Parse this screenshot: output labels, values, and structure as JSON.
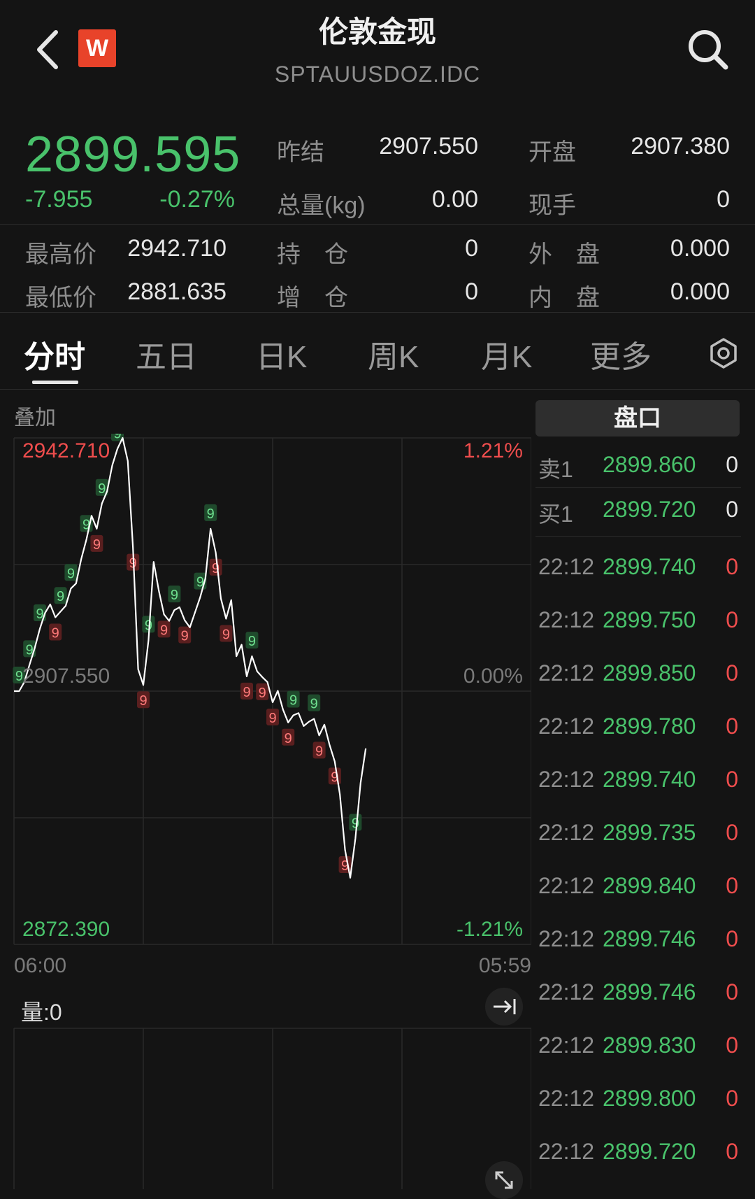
{
  "header": {
    "title": "伦敦金现",
    "subtitle": "SPTAUUSDOZ.IDC",
    "logo_letter": "W"
  },
  "quote": {
    "price": "2899.595",
    "change": "-7.955",
    "change_pct": "-0.27%",
    "fields": [
      {
        "label": "昨结",
        "value": "2907.550"
      },
      {
        "label": "开盘",
        "value": "2907.380"
      },
      {
        "label": "总量(kg)",
        "value": "0.00"
      },
      {
        "label": "现手",
        "value": "0"
      },
      {
        "label": "最高价",
        "value": "2942.710"
      },
      {
        "label": "持　仓",
        "value": "0"
      },
      {
        "label": "外　盘",
        "value": "0.000"
      },
      {
        "label": "最低价",
        "value": "2881.635"
      },
      {
        "label": "增　仓",
        "value": "0"
      },
      {
        "label": "内　盘",
        "value": "0.000"
      }
    ]
  },
  "tabs": [
    "分时",
    "五日",
    "日K",
    "周K",
    "月K",
    "更多"
  ],
  "chart": {
    "overlay_label": "叠加",
    "y_max_label": "2942.710",
    "y_mid_label": "2907.550",
    "y_min_label": "2872.390",
    "pct_max_label": "1.21%",
    "pct_mid_label": "0.00%",
    "pct_min_label": "-1.21%",
    "time_start": "06:00",
    "time_end": "05:59",
    "volume_label": "量:0"
  },
  "chart_data": {
    "type": "line",
    "title": "",
    "xlabel": "",
    "ylabel": "",
    "ylim": [
      2872.39,
      2942.71
    ],
    "x_range": [
      "06:00",
      "05:59"
    ],
    "reference": 2907.55,
    "series": [
      {
        "values": [
          2907.55,
          2907.55,
          2908.8,
          2911.2,
          2913.5,
          2916.2,
          2918.4,
          2919.6,
          2917.8,
          2918.6,
          2919.4,
          2921.8,
          2922.5,
          2925.9,
          2928.6,
          2931.9,
          2930.1,
          2933.6,
          2935.3,
          2938.9,
          2941.2,
          2942.71,
          2939.5,
          2927.5,
          2910.6,
          2908.4,
          2914.6,
          2925.5,
          2921.5,
          2918.2,
          2917.3,
          2918.8,
          2919.2,
          2917.4,
          2916.4,
          2918.5,
          2920.6,
          2923.2,
          2930.1,
          2926.8,
          2920.4,
          2917.6,
          2920.2,
          2912.4,
          2914.0,
          2909.6,
          2912.4,
          2910.3,
          2909.5,
          2908.8,
          2906.0,
          2907.6,
          2905.0,
          2903.2,
          2904.2,
          2904.5,
          2902.7,
          2903.3,
          2903.7,
          2901.4,
          2902.9,
          2900.1,
          2897.8,
          2893.2,
          2885.5,
          2881.64,
          2887.1,
          2894.8,
          2899.6
        ]
      }
    ],
    "markers": {
      "green_9": 16,
      "red_9": 15
    }
  },
  "orderbook": {
    "button": "盘口",
    "asks": [
      {
        "label": "卖1",
        "price": "2899.860",
        "qty": "0"
      }
    ],
    "bids": [
      {
        "label": "买1",
        "price": "2899.720",
        "qty": "0"
      }
    ],
    "ticks": [
      {
        "time": "22:12",
        "price": "2899.740",
        "qty": "0"
      },
      {
        "time": "22:12",
        "price": "2899.750",
        "qty": "0"
      },
      {
        "time": "22:12",
        "price": "2899.850",
        "qty": "0"
      },
      {
        "time": "22:12",
        "price": "2899.780",
        "qty": "0"
      },
      {
        "time": "22:12",
        "price": "2899.740",
        "qty": "0"
      },
      {
        "time": "22:12",
        "price": "2899.735",
        "qty": "0"
      },
      {
        "time": "22:12",
        "price": "2899.840",
        "qty": "0"
      },
      {
        "time": "22:12",
        "price": "2899.746",
        "qty": "0"
      },
      {
        "time": "22:12",
        "price": "2899.746",
        "qty": "0"
      },
      {
        "time": "22:12",
        "price": "2899.830",
        "qty": "0"
      },
      {
        "time": "22:12",
        "price": "2899.800",
        "qty": "0"
      },
      {
        "time": "22:12",
        "price": "2899.720",
        "qty": "0"
      }
    ]
  },
  "colors": {
    "background": "#141414",
    "up": "#ef4d4d",
    "down": "#49c26b",
    "line": "#ffffff",
    "logo": "#e8432a"
  }
}
